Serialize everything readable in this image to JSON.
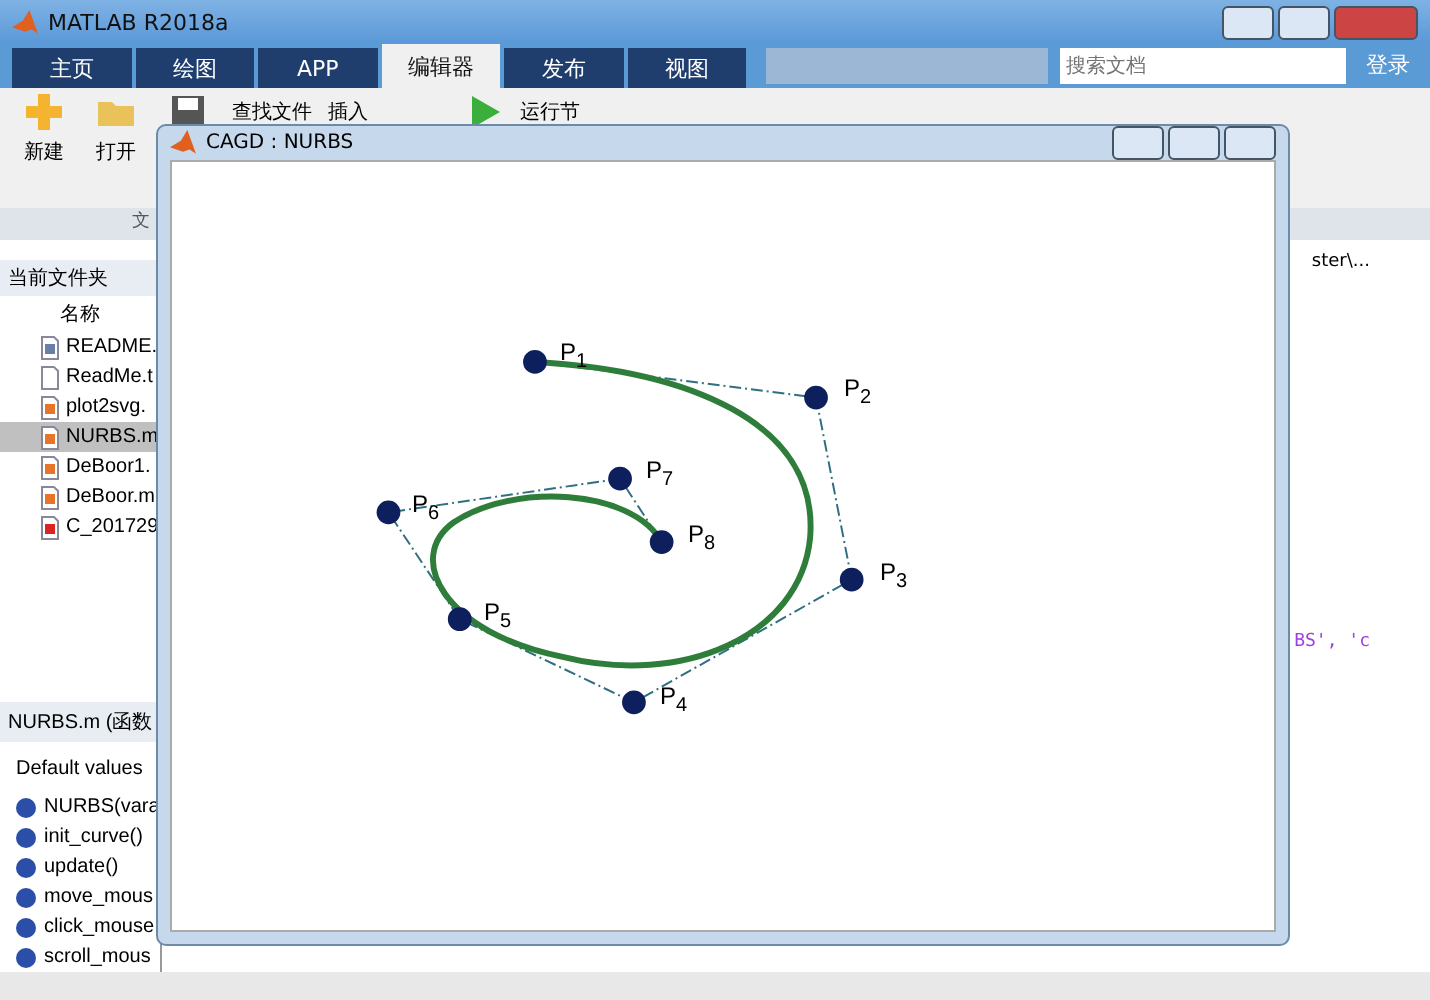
{
  "window": {
    "title": "MATLAB R2018a"
  },
  "tabs": [
    {
      "label": "主页",
      "selected": false
    },
    {
      "label": "绘图",
      "selected": false
    },
    {
      "label": "APP",
      "selected": false
    },
    {
      "label": "编辑器",
      "selected": true
    },
    {
      "label": "发布",
      "selected": false
    },
    {
      "label": "视图",
      "selected": false
    }
  ],
  "search": {
    "placeholder": "搜索文档"
  },
  "login": "登录",
  "ribbon": {
    "new": "新建",
    "open": "打开",
    "find_files": "查找文件",
    "insert": "插入",
    "run_section": "运行节",
    "group_label": "文"
  },
  "file_browser": {
    "title": "当前文件夹",
    "column": "名称",
    "files": [
      {
        "name": "README.",
        "kind": "text",
        "selected": false
      },
      {
        "name": "ReadMe.t",
        "kind": "blank",
        "selected": false
      },
      {
        "name": "plot2svg.",
        "kind": "mfile",
        "selected": false
      },
      {
        "name": "NURBS.m",
        "kind": "mfile",
        "selected": true
      },
      {
        "name": "DeBoor1.",
        "kind": "mfile",
        "selected": false
      },
      {
        "name": "DeBoor.m",
        "kind": "mfile",
        "selected": false
      },
      {
        "name": "C_201729",
        "kind": "pdf",
        "selected": false
      }
    ]
  },
  "details": {
    "title": "NURBS.m  (函数",
    "subtitle": "Default values",
    "functions": [
      "NURBS(vara",
      "init_curve()",
      "update()",
      "move_mous",
      "click_mouse",
      "scroll_mous"
    ]
  },
  "editor": {
    "path": "ster\\...",
    "code_fragment": "BS', 'c"
  },
  "figure": {
    "title": "CAGD : NURBS",
    "points": [
      "P$_{1}$",
      "P$_{2}$",
      "P$_{3}$",
      "P$_{4}$",
      "P$_{5}$",
      "P$_{6}$",
      "P$_{7}$",
      "P$_{8}$"
    ]
  }
}
